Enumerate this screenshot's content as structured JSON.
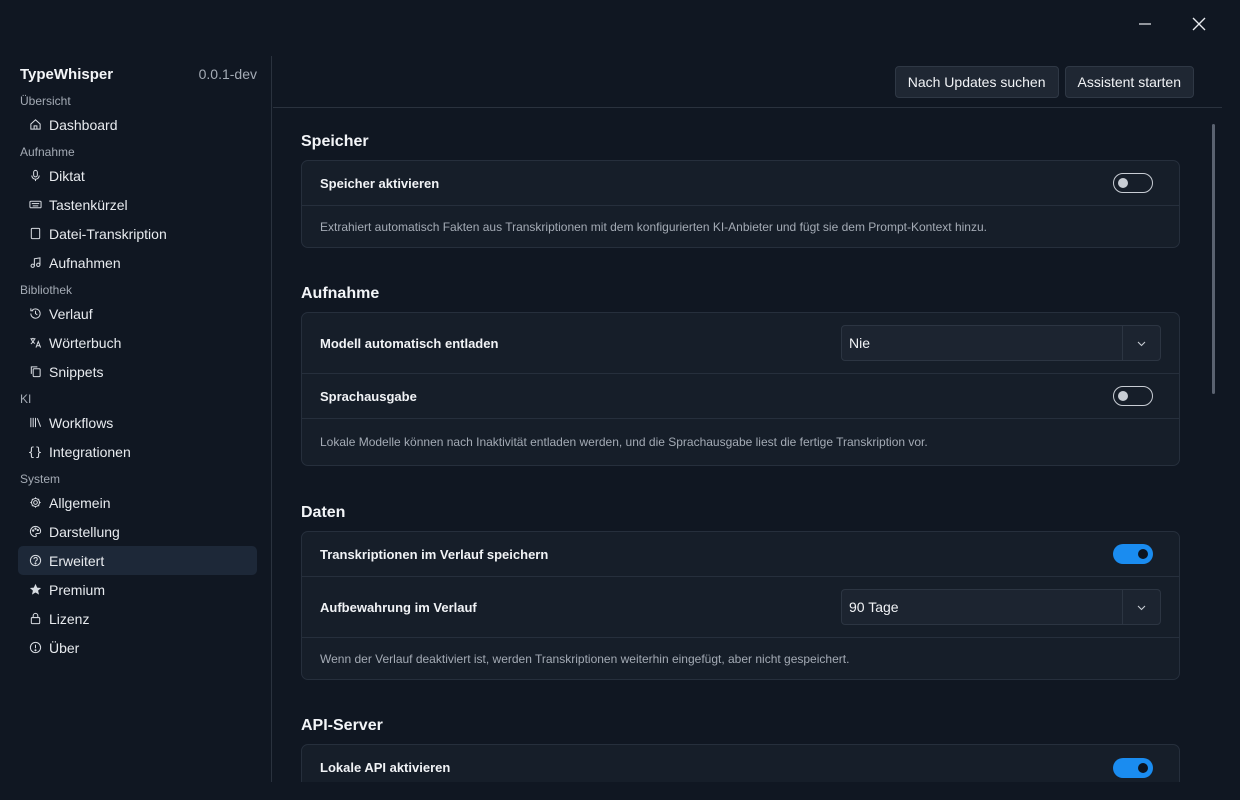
{
  "app": {
    "name": "TypeWhisper",
    "version": "0.0.1-dev"
  },
  "sidebar": {
    "sections": [
      {
        "label": "Übersicht",
        "items": [
          {
            "label": "Dashboard",
            "icon": "home-icon"
          }
        ]
      },
      {
        "label": "Aufnahme",
        "items": [
          {
            "label": "Diktat",
            "icon": "microphone-icon"
          },
          {
            "label": "Tastenkürzel",
            "icon": "keyboard-icon"
          },
          {
            "label": "Datei-Transkription",
            "icon": "file-icon"
          },
          {
            "label": "Aufnahmen",
            "icon": "music-note-icon"
          }
        ]
      },
      {
        "label": "Bibliothek",
        "items": [
          {
            "label": "Verlauf",
            "icon": "history-icon"
          },
          {
            "label": "Wörterbuch",
            "icon": "translate-icon"
          },
          {
            "label": "Snippets",
            "icon": "copy-icon"
          }
        ]
      },
      {
        "label": "KI",
        "items": [
          {
            "label": "Workflows",
            "icon": "library-icon"
          },
          {
            "label": "Integrationen",
            "icon": "braces-icon"
          }
        ]
      },
      {
        "label": "System",
        "items": [
          {
            "label": "Allgemein",
            "icon": "gear-icon"
          },
          {
            "label": "Darstellung",
            "icon": "palette-icon"
          },
          {
            "label": "Erweitert",
            "icon": "help-circle-icon",
            "active": true
          },
          {
            "label": "Premium",
            "icon": "star-icon"
          },
          {
            "label": "Lizenz",
            "icon": "lock-icon"
          },
          {
            "label": "Über",
            "icon": "info-icon"
          }
        ]
      }
    ]
  },
  "toolbar": {
    "check_updates": "Nach Updates suchen",
    "start_assistant": "Assistent starten"
  },
  "content": {
    "speicher": {
      "title": "Speicher",
      "enable_label": "Speicher aktivieren",
      "enable_on": false,
      "description": "Extrahiert automatisch Fakten aus Transkriptionen mit dem konfigurierten KI-Anbieter und fügt sie dem Prompt-Kontext hinzu."
    },
    "aufnahme": {
      "title": "Aufnahme",
      "unload_label": "Modell automatisch entladen",
      "unload_value": "Nie",
      "speech_label": "Sprachausgabe",
      "speech_on": false,
      "description": "Lokale Modelle können nach Inaktivität entladen werden, und die Sprachausgabe liest die fertige Transkription vor."
    },
    "daten": {
      "title": "Daten",
      "save_label": "Transkriptionen im Verlauf speichern",
      "save_on": true,
      "retention_label": "Aufbewahrung im Verlauf",
      "retention_value": "90 Tage",
      "description": "Wenn der Verlauf deaktiviert ist, werden Transkriptionen weiterhin eingefügt, aber nicht gespeichert."
    },
    "api": {
      "title": "API-Server",
      "enable_label": "Lokale API aktivieren",
      "enable_on": true
    }
  }
}
